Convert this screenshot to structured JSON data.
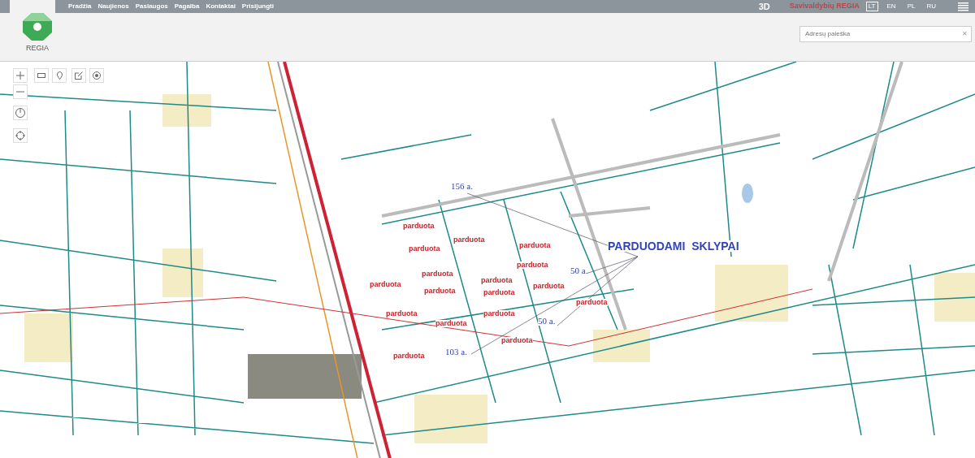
{
  "logo": {
    "text": "REGIA"
  },
  "nav": [
    "Pradžia",
    "Naujienos",
    "Paslaugos",
    "Pagalba",
    "Kontaktai",
    "Prisijungti"
  ],
  "mode_3d": "3D",
  "brand": "Savivaldybių REGIA",
  "languages": [
    {
      "label": "LT",
      "selected": true
    },
    {
      "label": "EN",
      "selected": false
    },
    {
      "label": "PL",
      "selected": false
    },
    {
      "label": "RU",
      "selected": false
    }
  ],
  "search": {
    "placeholder": "Adresų paieška",
    "clear": "✕"
  },
  "map": {
    "annotations": [
      {
        "kind": "area",
        "text": "156 a."
      },
      {
        "kind": "title",
        "text": "PARDUODAMI  SKLYPAI"
      },
      {
        "kind": "area",
        "text": "50 a."
      },
      {
        "kind": "area",
        "text": "50 a."
      },
      {
        "kind": "area",
        "text": "103 a."
      },
      {
        "kind": "sold",
        "text": "parduota"
      },
      {
        "kind": "sold",
        "text": "parduota"
      },
      {
        "kind": "sold",
        "text": "parduota"
      },
      {
        "kind": "sold",
        "text": "parduota"
      },
      {
        "kind": "sold",
        "text": "parduota"
      },
      {
        "kind": "sold",
        "text": "parduota"
      },
      {
        "kind": "sold",
        "text": "parduota"
      },
      {
        "kind": "sold",
        "text": "parduota"
      },
      {
        "kind": "sold",
        "text": "parduota"
      },
      {
        "kind": "sold",
        "text": "parduota"
      },
      {
        "kind": "sold",
        "text": "parduota"
      },
      {
        "kind": "sold",
        "text": "parduota"
      },
      {
        "kind": "sold",
        "text": "parduota"
      },
      {
        "kind": "sold",
        "text": "parduota"
      },
      {
        "kind": "sold",
        "text": "parduota"
      },
      {
        "kind": "sold",
        "text": "parduota"
      },
      {
        "kind": "sold",
        "text": "parduota"
      }
    ]
  }
}
